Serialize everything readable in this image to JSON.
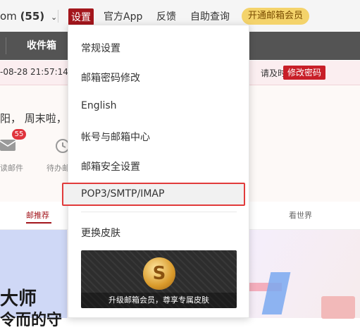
{
  "topbar": {
    "account_domain": "om",
    "account_count": "(55)",
    "nav": {
      "settings": "设置",
      "official_app": "官方App",
      "feedback": "反馈",
      "self_service": "自助查询",
      "vip": "开通邮箱会员"
    }
  },
  "tabs": {
    "inbox": "收件箱"
  },
  "notice": {
    "time_text": "-08-28 21:57:14",
    "text_fragment": "请及时",
    "change_password": "修改密码"
  },
  "greeting": {
    "text": "阳，  周末啦，",
    "unread_badge": "55",
    "unread_label": "读邮件",
    "todo_label": "待办邮"
  },
  "feed": {
    "recommended": "邮推荐",
    "world": "看世界"
  },
  "banner": {
    "title": "大师",
    "subtitle": "令而的守"
  },
  "dropdown": {
    "items": [
      "常规设置",
      "邮箱密码修改",
      "English",
      "帐号与邮箱中心",
      "邮箱安全设置",
      "POP3/SMTP/IMAP",
      "更换皮肤"
    ],
    "highlighted_index": 5,
    "skin_caption": "升级邮箱会员，尊享专属皮肤",
    "coin_symbol": "S"
  },
  "colors": {
    "brand_red": "#a3161c",
    "highlight_border": "#e13b3b",
    "vip_gold": "#f4d36b"
  }
}
